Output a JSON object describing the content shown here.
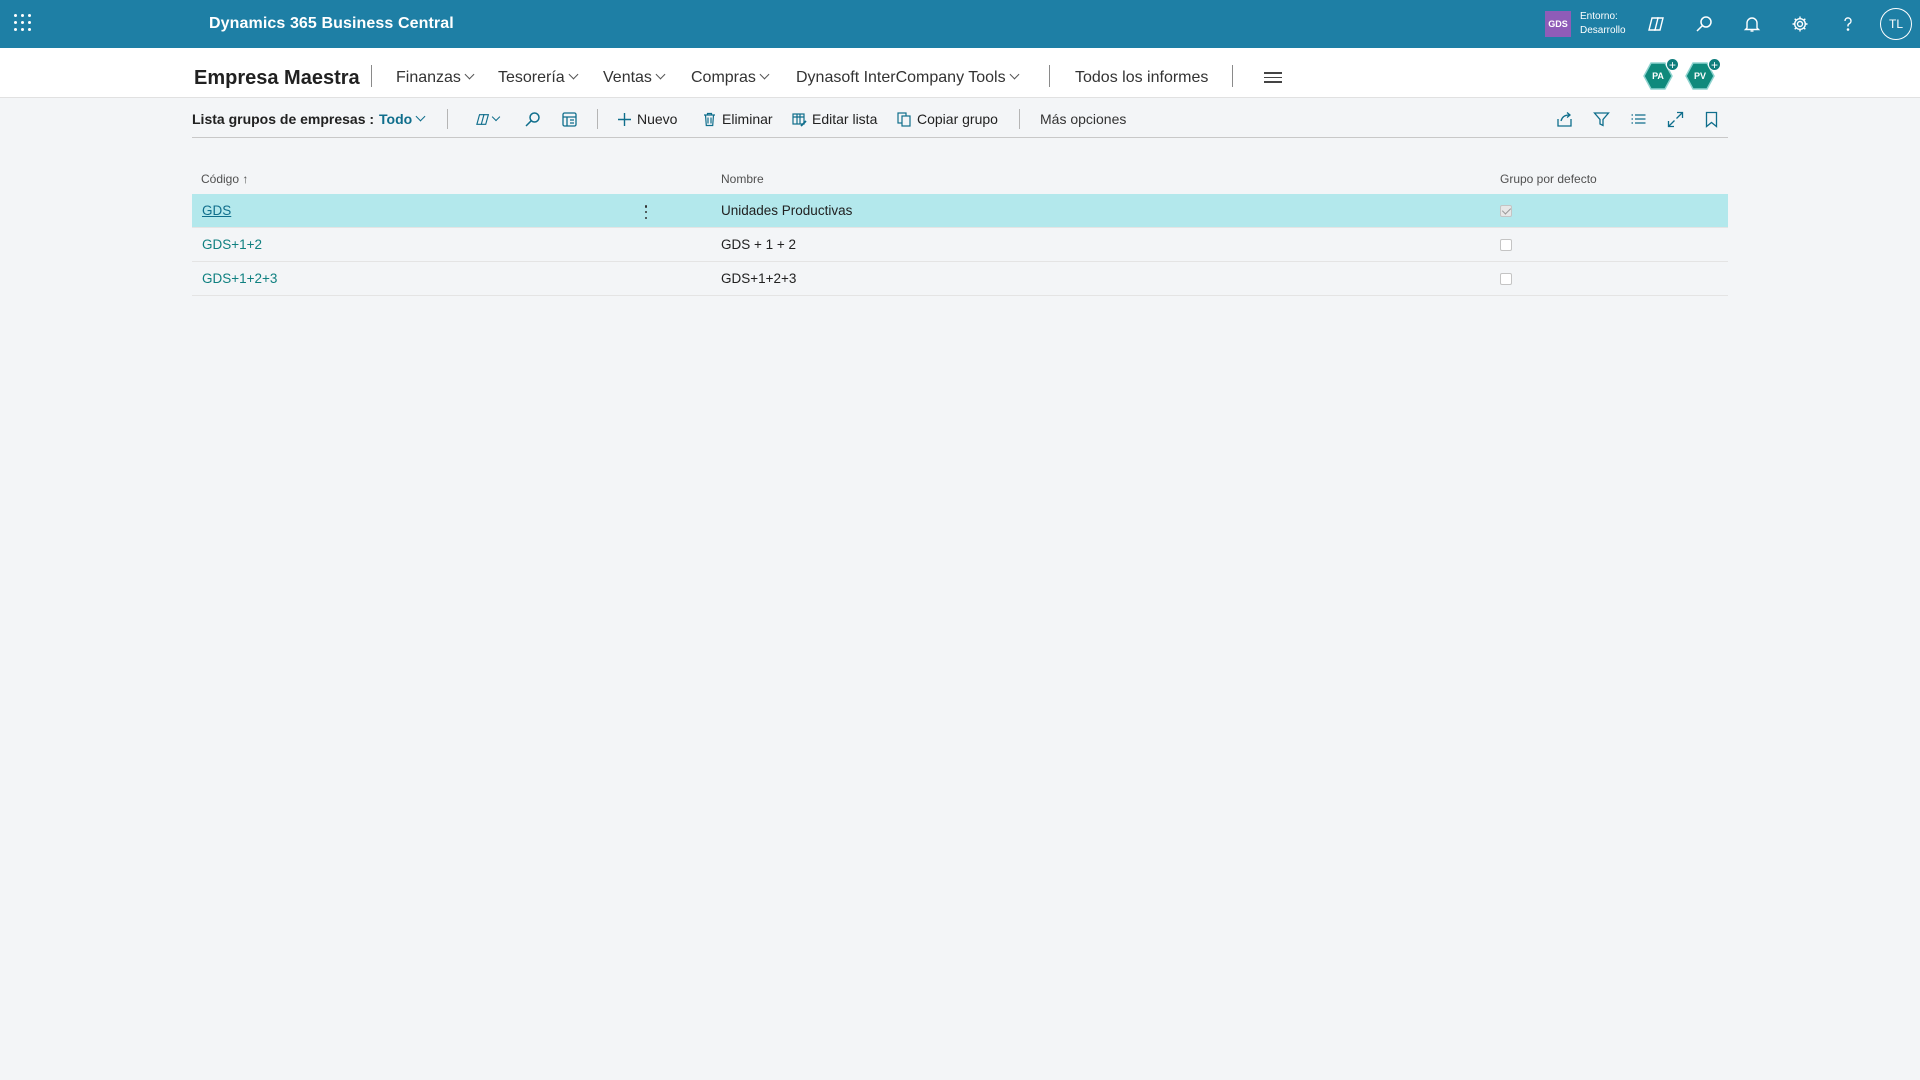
{
  "header": {
    "app_title": "Dynamics 365 Business Central",
    "environment_badge": "GDS",
    "environment_line1": "Entorno:",
    "environment_line2": "Desarrollo",
    "user_initials": "TL",
    "brand_color": "#1e7fa5"
  },
  "nav": {
    "company": "Empresa Maestra",
    "menus": [
      "Finanzas",
      "Tesorería",
      "Ventas",
      "Compras",
      "Dynasoft InterCompany Tools"
    ],
    "all_reports": "Todos los informes",
    "badges": [
      "PA",
      "PV"
    ]
  },
  "actionbar": {
    "title": "Lista grupos de empresas :",
    "filter_value": "Todo",
    "new_label": "Nuevo",
    "delete_label": "Eliminar",
    "edit_list_label": "Editar lista",
    "copy_group_label": "Copiar grupo",
    "more_options_label": "Más opciones"
  },
  "table": {
    "columns": {
      "code": "Código",
      "code_sort_indicator": "↑",
      "name": "Nombre",
      "default_group": "Grupo por defecto"
    },
    "rows": [
      {
        "code": "GDS",
        "name": "Unidades Productivas",
        "default": true,
        "selected": true
      },
      {
        "code": "GDS+1+2",
        "name": "GDS + 1 + 2",
        "default": false,
        "selected": false
      },
      {
        "code": "GDS+1+2+3",
        "name": "GDS+1+2+3",
        "default": false,
        "selected": false
      }
    ]
  }
}
